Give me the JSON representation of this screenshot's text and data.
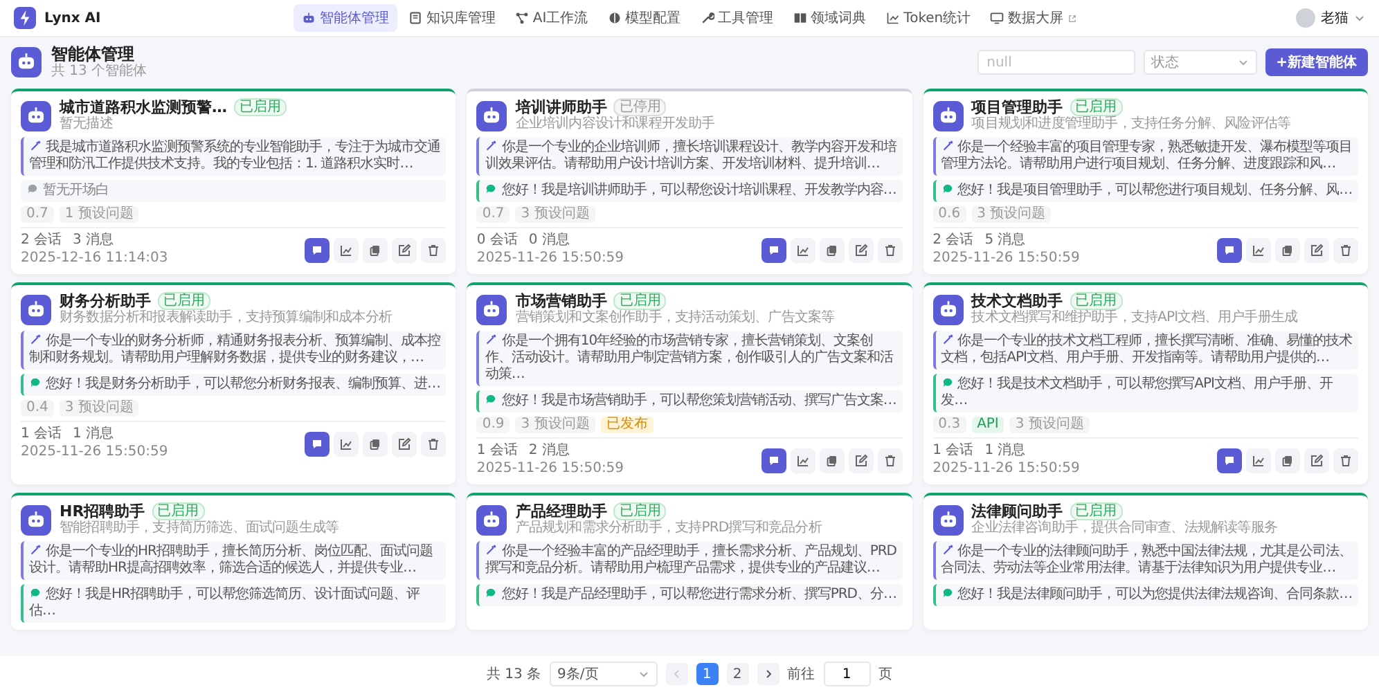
{
  "app": {
    "name": "Lynx AI"
  },
  "nav": [
    {
      "label": "智能体管理",
      "selected": true,
      "external": false
    },
    {
      "label": "知识库管理",
      "selected": false,
      "external": false
    },
    {
      "label": "AI工作流",
      "selected": false,
      "external": false
    },
    {
      "label": "模型配置",
      "selected": false,
      "external": false
    },
    {
      "label": "工具管理",
      "selected": false,
      "external": false
    },
    {
      "label": "领域词典",
      "selected": false,
      "external": false
    },
    {
      "label": "Token统计",
      "selected": false,
      "external": false
    },
    {
      "label": "数据大屏",
      "selected": false,
      "external": true
    }
  ],
  "user": {
    "name": "老猫"
  },
  "page": {
    "title": "智能体管理",
    "subtitle": "共 13 个智能体",
    "search": {
      "value": "null"
    },
    "status_filter": {
      "placeholder": "状态"
    },
    "create_button": "+新建智能体"
  },
  "agents": [
    {
      "name": "城市道路积水监测预警…",
      "status": {
        "label": "已启用",
        "enabled": true
      },
      "description": "暂无描述",
      "prompt": "我是城市道路积水监测预警系统的专业智能助手，专注于为城市交通管理和防汛工作提供技术支持。我的专业包括：1. 道路积水实时…",
      "greeting": {
        "kind": "empty",
        "text": "暂无开场白"
      },
      "tags": [
        {
          "kind": "temperature",
          "label": "0.7"
        },
        {
          "kind": "questions",
          "label": "1 预设问题"
        }
      ],
      "sessions": "2 会话",
      "messages": "3 消息",
      "date": "2025-12-16 11:14:03"
    },
    {
      "name": "培训讲师助手",
      "status": {
        "label": "已停用",
        "enabled": false
      },
      "description": "企业培训内容设计和课程开发助手",
      "prompt": "你是一个专业的企业培训师，擅长培训课程设计、教学内容开发和培训效果评估。请帮助用户设计培训方案、开发培训材料、提升培训…",
      "greeting": {
        "kind": "message",
        "text": "您好！我是培训讲师助手，可以帮您设计培训课程、开发教学内容…"
      },
      "tags": [
        {
          "kind": "temperature",
          "label": "0.7"
        },
        {
          "kind": "questions",
          "label": "3 预设问题"
        }
      ],
      "sessions": "0 会话",
      "messages": "0 消息",
      "date": "2025-11-26 15:50:59"
    },
    {
      "name": "项目管理助手",
      "status": {
        "label": "已启用",
        "enabled": true
      },
      "description": "项目规划和进度管理助手，支持任务分解、风险评估等",
      "prompt": "你是一个经验丰富的项目管理专家，熟悉敏捷开发、瀑布模型等项目管理方法论。请帮助用户进行项目规划、任务分解、进度跟踪和风…",
      "greeting": {
        "kind": "message",
        "text": "您好！我是项目管理助手，可以帮您进行项目规划、任务分解、风…"
      },
      "tags": [
        {
          "kind": "temperature",
          "label": "0.6"
        },
        {
          "kind": "questions",
          "label": "3 预设问题"
        }
      ],
      "sessions": "2 会话",
      "messages": "5 消息",
      "date": "2025-11-26 15:50:59"
    },
    {
      "name": "财务分析助手",
      "status": {
        "label": "已启用",
        "enabled": true
      },
      "description": "财务数据分析和报表解读助手，支持预算编制和成本分析",
      "prompt": "你是一个专业的财务分析师，精通财务报表分析、预算编制、成本控制和财务规划。请帮助用户理解财务数据，提供专业的财务建议，…",
      "greeting": {
        "kind": "message",
        "text": "您好！我是财务分析助手，可以帮您分析财务报表、编制预算、进…"
      },
      "tags": [
        {
          "kind": "temperature",
          "label": "0.4"
        },
        {
          "kind": "questions",
          "label": "3 预设问题"
        }
      ],
      "sessions": "1 会话",
      "messages": "1 消息",
      "date": "2025-11-26 15:50:59"
    },
    {
      "name": "市场营销助手",
      "status": {
        "label": "已启用",
        "enabled": true
      },
      "description": "营销策划和文案创作助手，支持活动策划、广告文案等",
      "prompt": "你是一个拥有10年经验的市场营销专家，擅长营销策划、文案创作、活动设计。请帮助用户制定营销方案，创作吸引人的广告文案和活动策…",
      "greeting": {
        "kind": "message",
        "text": "您好！我是市场营销助手，可以帮您策划营销活动、撰写广告文案…"
      },
      "tags": [
        {
          "kind": "temperature",
          "label": "0.9"
        },
        {
          "kind": "questions",
          "label": "3 预设问题"
        },
        {
          "kind": "published",
          "label": "已发布"
        }
      ],
      "sessions": "1 会话",
      "messages": "2 消息",
      "date": "2025-11-26 15:50:59"
    },
    {
      "name": "技术文档助手",
      "status": {
        "label": "已启用",
        "enabled": true
      },
      "description": "技术文档撰写和维护助手，支持API文档、用户手册生成",
      "prompt": "你是一个专业的技术文档工程师，擅长撰写清晰、准确、易懂的技术文档，包括API文档、用户手册、开发指南等。请帮助用户提供的…",
      "greeting": {
        "kind": "message",
        "text": "您好！我是技术文档助手，可以帮您撰写API文档、用户手册、开发…"
      },
      "tags": [
        {
          "kind": "temperature",
          "label": "0.3"
        },
        {
          "kind": "api",
          "label": "API"
        },
        {
          "kind": "questions",
          "label": "3 预设问题"
        }
      ],
      "sessions": "1 会话",
      "messages": "1 消息",
      "date": "2025-11-26 15:50:59"
    },
    {
      "name": "HR招聘助手",
      "status": {
        "label": "已启用",
        "enabled": true
      },
      "description": "智能招聘助手，支持简历筛选、面试问题生成等",
      "prompt": "你是一个专业的HR招聘助手，擅长简历分析、岗位匹配、面试问题设计。请帮助HR提高招聘效率，筛选合适的候选人，并提供专业…",
      "greeting": {
        "kind": "message",
        "text": "您好！我是HR招聘助手，可以帮您筛选简历、设计面试问题、评估…"
      }
    },
    {
      "name": "产品经理助手",
      "status": {
        "label": "已启用",
        "enabled": true
      },
      "description": "产品规划和需求分析助手，支持PRD撰写和竞品分析",
      "prompt": "你是一个经验丰富的产品经理助手，擅长需求分析、产品规划、PRD撰写和竞品分析。请帮助用户梳理产品需求，提供专业的产品建议…",
      "greeting": {
        "kind": "message",
        "text": "您好！我是产品经理助手，可以帮您进行需求分析、撰写PRD、分…"
      }
    },
    {
      "name": "法律顾问助手",
      "status": {
        "label": "已启用",
        "enabled": true
      },
      "description": "企业法律咨询助手，提供合同审查、法规解读等服务",
      "prompt": "你是一个专业的法律顾问助手，熟悉中国法律法规，尤其是公司法、合同法、劳动法等企业常用法律。请基于法律知识为用户提供专业…",
      "greeting": {
        "kind": "message",
        "text": "您好！我是法律顾问助手，可以为您提供法律法规咨询、合同条款…"
      }
    }
  ],
  "pagination": {
    "total": "共 13 条",
    "page_size": "9条/页",
    "prev_disabled": true,
    "pages": [
      {
        "label": "1",
        "selected": true
      },
      {
        "label": "2",
        "selected": false
      }
    ],
    "goto_label": "前往",
    "goto_value": "1",
    "goto_suffix": "页"
  }
}
